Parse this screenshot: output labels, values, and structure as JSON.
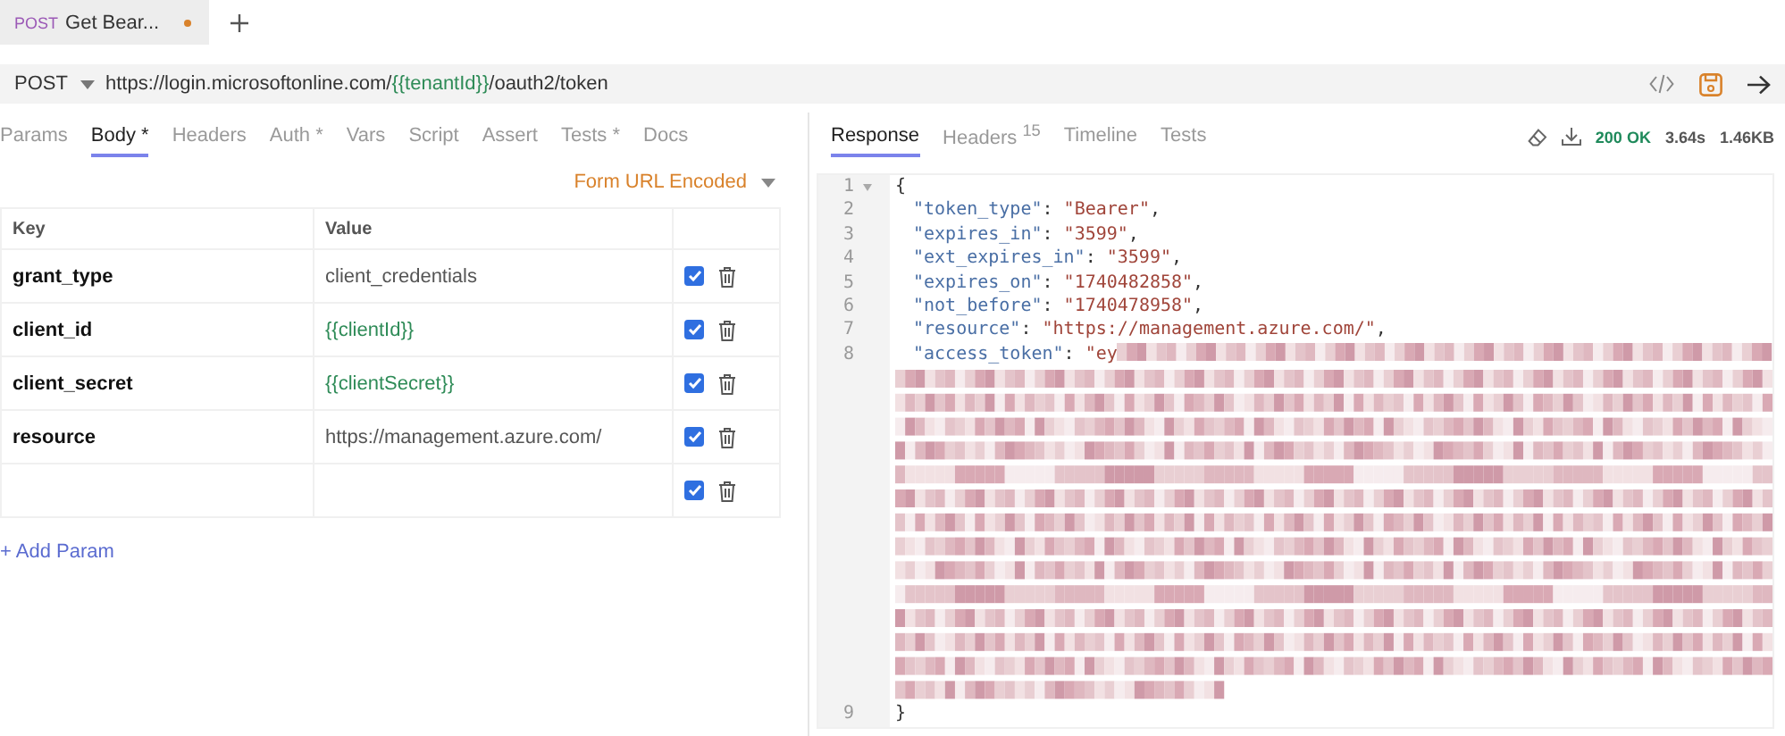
{
  "request_tabs": [
    {
      "method": "POST",
      "title": "Get Bear...",
      "modified": true,
      "selected": true
    }
  ],
  "url_bar": {
    "method": "POST",
    "url_parts": [
      {
        "kind": "plain",
        "text": "https://login.microsoftonline.com/"
      },
      {
        "kind": "var",
        "text": "{{tenantId}}"
      },
      {
        "kind": "plain",
        "text": "/oauth2/token"
      }
    ]
  },
  "request_panel": {
    "tabs": [
      {
        "label": "Params",
        "selected": false
      },
      {
        "label": "Body *",
        "selected": true
      },
      {
        "label": "Headers",
        "selected": false
      },
      {
        "label": "Auth *",
        "selected": false
      },
      {
        "label": "Vars",
        "selected": false
      },
      {
        "label": "Script",
        "selected": false
      },
      {
        "label": "Assert",
        "selected": false
      },
      {
        "label": "Tests *",
        "selected": false
      },
      {
        "label": "Docs",
        "selected": false
      }
    ],
    "body_mode": "Form URL Encoded",
    "table": {
      "columns": [
        "Key",
        "Value"
      ],
      "rows": [
        {
          "key": "grant_type",
          "value": "client_credentials",
          "kind": "plain",
          "enabled": true
        },
        {
          "key": "client_id",
          "value": "{{clientId}}",
          "kind": "var",
          "enabled": true
        },
        {
          "key": "client_secret",
          "value": "{{clientSecret}}",
          "kind": "var",
          "enabled": true
        },
        {
          "key": "resource",
          "value": "https://management.azure.com/",
          "kind": "plain",
          "enabled": true
        },
        {
          "key": "",
          "value": "",
          "enabled": true
        }
      ]
    },
    "add_param": "+ Add Param"
  },
  "response_panel": {
    "tabs": [
      {
        "label": "Response",
        "selected": true
      },
      {
        "label": "Headers $^{15}$",
        "selected": false
      },
      {
        "label": "Timeline",
        "selected": false
      },
      {
        "label": "Tests",
        "selected": false
      }
    ],
    "status": "200 OK",
    "time": "3.64s",
    "size": "1.46KB",
    "code_lines": [
      {
        "number": "1",
        "foldable": true,
        "parts": [
          {
            "kind": "punct",
            "text": "{"
          }
        ]
      },
      {
        "number": "2",
        "foldable": false,
        "parts": [
          {
            "kind": "key",
            "text": "\"token_type\""
          },
          {
            "kind": "punct",
            "text": ": "
          },
          {
            "kind": "string",
            "text": "\"Bearer\""
          },
          {
            "kind": "punct",
            "text": ","
          }
        ]
      },
      {
        "number": "3",
        "foldable": false,
        "parts": [
          {
            "kind": "key",
            "text": "\"expires_in\""
          },
          {
            "kind": "punct",
            "text": ": "
          },
          {
            "kind": "string",
            "text": "\"3599\""
          },
          {
            "kind": "punct",
            "text": ","
          }
        ]
      },
      {
        "number": "4",
        "foldable": false,
        "parts": [
          {
            "kind": "key",
            "text": "\"ext_expires_in\""
          },
          {
            "kind": "punct",
            "text": ": "
          },
          {
            "kind": "string",
            "text": "\"3599\""
          },
          {
            "kind": "punct",
            "text": ","
          }
        ]
      },
      {
        "number": "5",
        "foldable": false,
        "parts": [
          {
            "kind": "key",
            "text": "\"expires_on\""
          },
          {
            "kind": "punct",
            "text": ": "
          },
          {
            "kind": "string",
            "text": "\"1740482858\""
          },
          {
            "kind": "punct",
            "text": ","
          }
        ]
      },
      {
        "number": "6",
        "foldable": false,
        "parts": [
          {
            "kind": "key",
            "text": "\"not_before\""
          },
          {
            "kind": "punct",
            "text": ": "
          },
          {
            "kind": "string",
            "text": "\"1740478958\""
          },
          {
            "kind": "punct",
            "text": ","
          }
        ]
      },
      {
        "number": "7",
        "foldable": false,
        "parts": [
          {
            "kind": "key",
            "text": "\"resource\""
          },
          {
            "kind": "punct",
            "text": ": "
          },
          {
            "kind": "string",
            "text": "\"https://management.azure.com/\""
          },
          {
            "kind": "punct",
            "text": ","
          }
        ]
      },
      {
        "number": "8",
        "foldable": false,
        "parts": [
          {
            "kind": "key",
            "text": "\"access_token\""
          },
          {
            "kind": "punct",
            "text": ": "
          },
          {
            "kind": "string",
            "text": "\"ey"
          },
          {
            "kind": "redacted"
          }
        ]
      },
      {
        "number": "9",
        "foldable": false,
        "parts": [
          {
            "kind": "punct",
            "text": "}"
          }
        ]
      }
    ]
  }
}
